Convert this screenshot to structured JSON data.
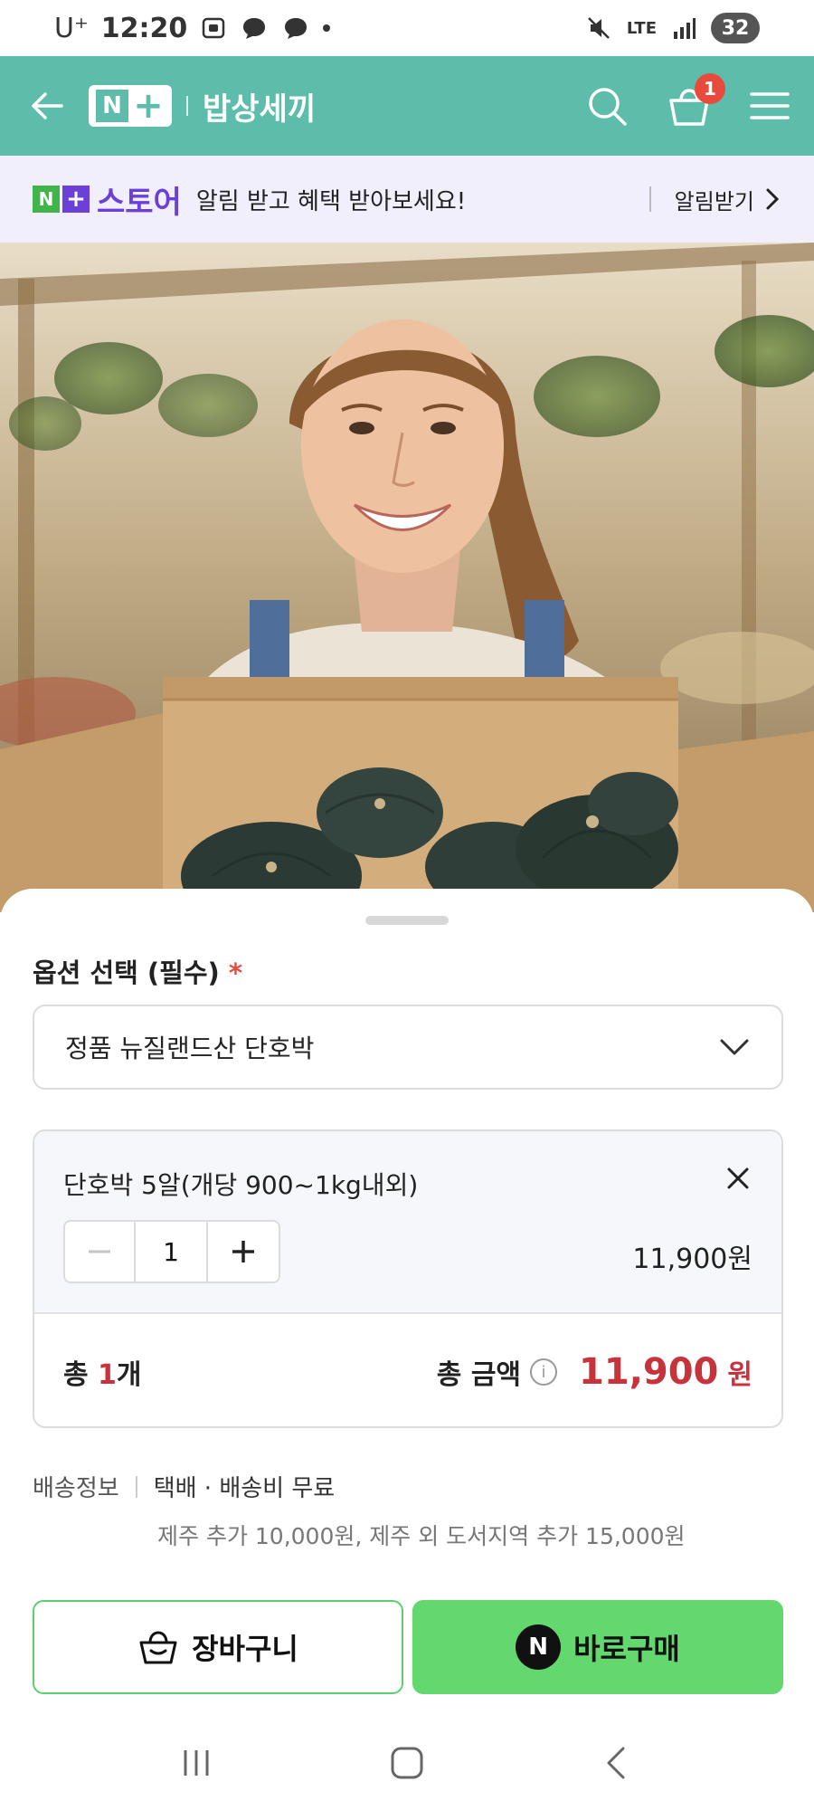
{
  "status_bar": {
    "carrier": "U⁺",
    "time": "12:20",
    "network": "LTE",
    "battery": "32"
  },
  "header": {
    "store_name": "밥상세끼",
    "cart_count": "1",
    "brand_color": "#5ebdaa"
  },
  "promo": {
    "store_label": "스토어",
    "text": "알림 받고 혜택 받아보세요!",
    "action_label": "알림받기"
  },
  "option": {
    "title": "옵션 선택 (필수)",
    "required_mark": "*",
    "selected_value": "정품 뉴질랜드산 단호박"
  },
  "item": {
    "name": "단호박 5알(개당 900~1kg내외)",
    "quantity": "1",
    "price": "11,900원"
  },
  "total": {
    "count_prefix": "총 ",
    "count_num": "1",
    "count_suffix": "개",
    "amount_label": "총 금액",
    "amount": "11,900",
    "currency": "원"
  },
  "shipping": {
    "label": "배송정보",
    "method": "택배 · 배송비 무료",
    "extra": "제주 추가 10,000원, 제주 외 도서지역 추가 15,000원"
  },
  "actions": {
    "cart_label": "장바구니",
    "buy_label": "바로구매",
    "buy_color": "#62d86f"
  }
}
